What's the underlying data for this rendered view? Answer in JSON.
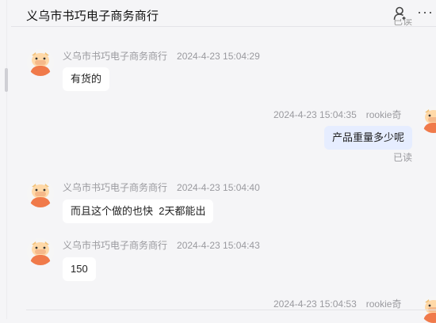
{
  "header": {
    "title": "义乌市书巧电子商务商行",
    "icons": [
      "user-icon",
      "more-icon"
    ]
  },
  "top_read_label": "已读",
  "messages": [
    {
      "sender": "义乌市书巧电子商务商行",
      "time": "2024-4-23 15:04:29",
      "text": "有货的",
      "side": "left"
    },
    {
      "sender": "rookie奇",
      "time": "2024-4-23 15:04:35",
      "text": "产品重量多少呢",
      "side": "right",
      "status": "已读"
    },
    {
      "sender": "义乌市书巧电子商务商行",
      "time": "2024-4-23 15:04:40",
      "text": "而且这个做的也快  2天都能出",
      "side": "left"
    },
    {
      "sender": "义乌市书巧电子商务商行",
      "time": "2024-4-23 15:04:43",
      "text": "150",
      "side": "left"
    },
    {
      "sender": "rookie奇",
      "time": "2024-4-23 15:04:53",
      "text": "",
      "side": "right"
    }
  ],
  "colors": {
    "avatar_body": "#f07a4a",
    "avatar_face": "#ffd9a8",
    "bubble_mine": "#e6edff",
    "bubble_other": "#ffffff"
  }
}
